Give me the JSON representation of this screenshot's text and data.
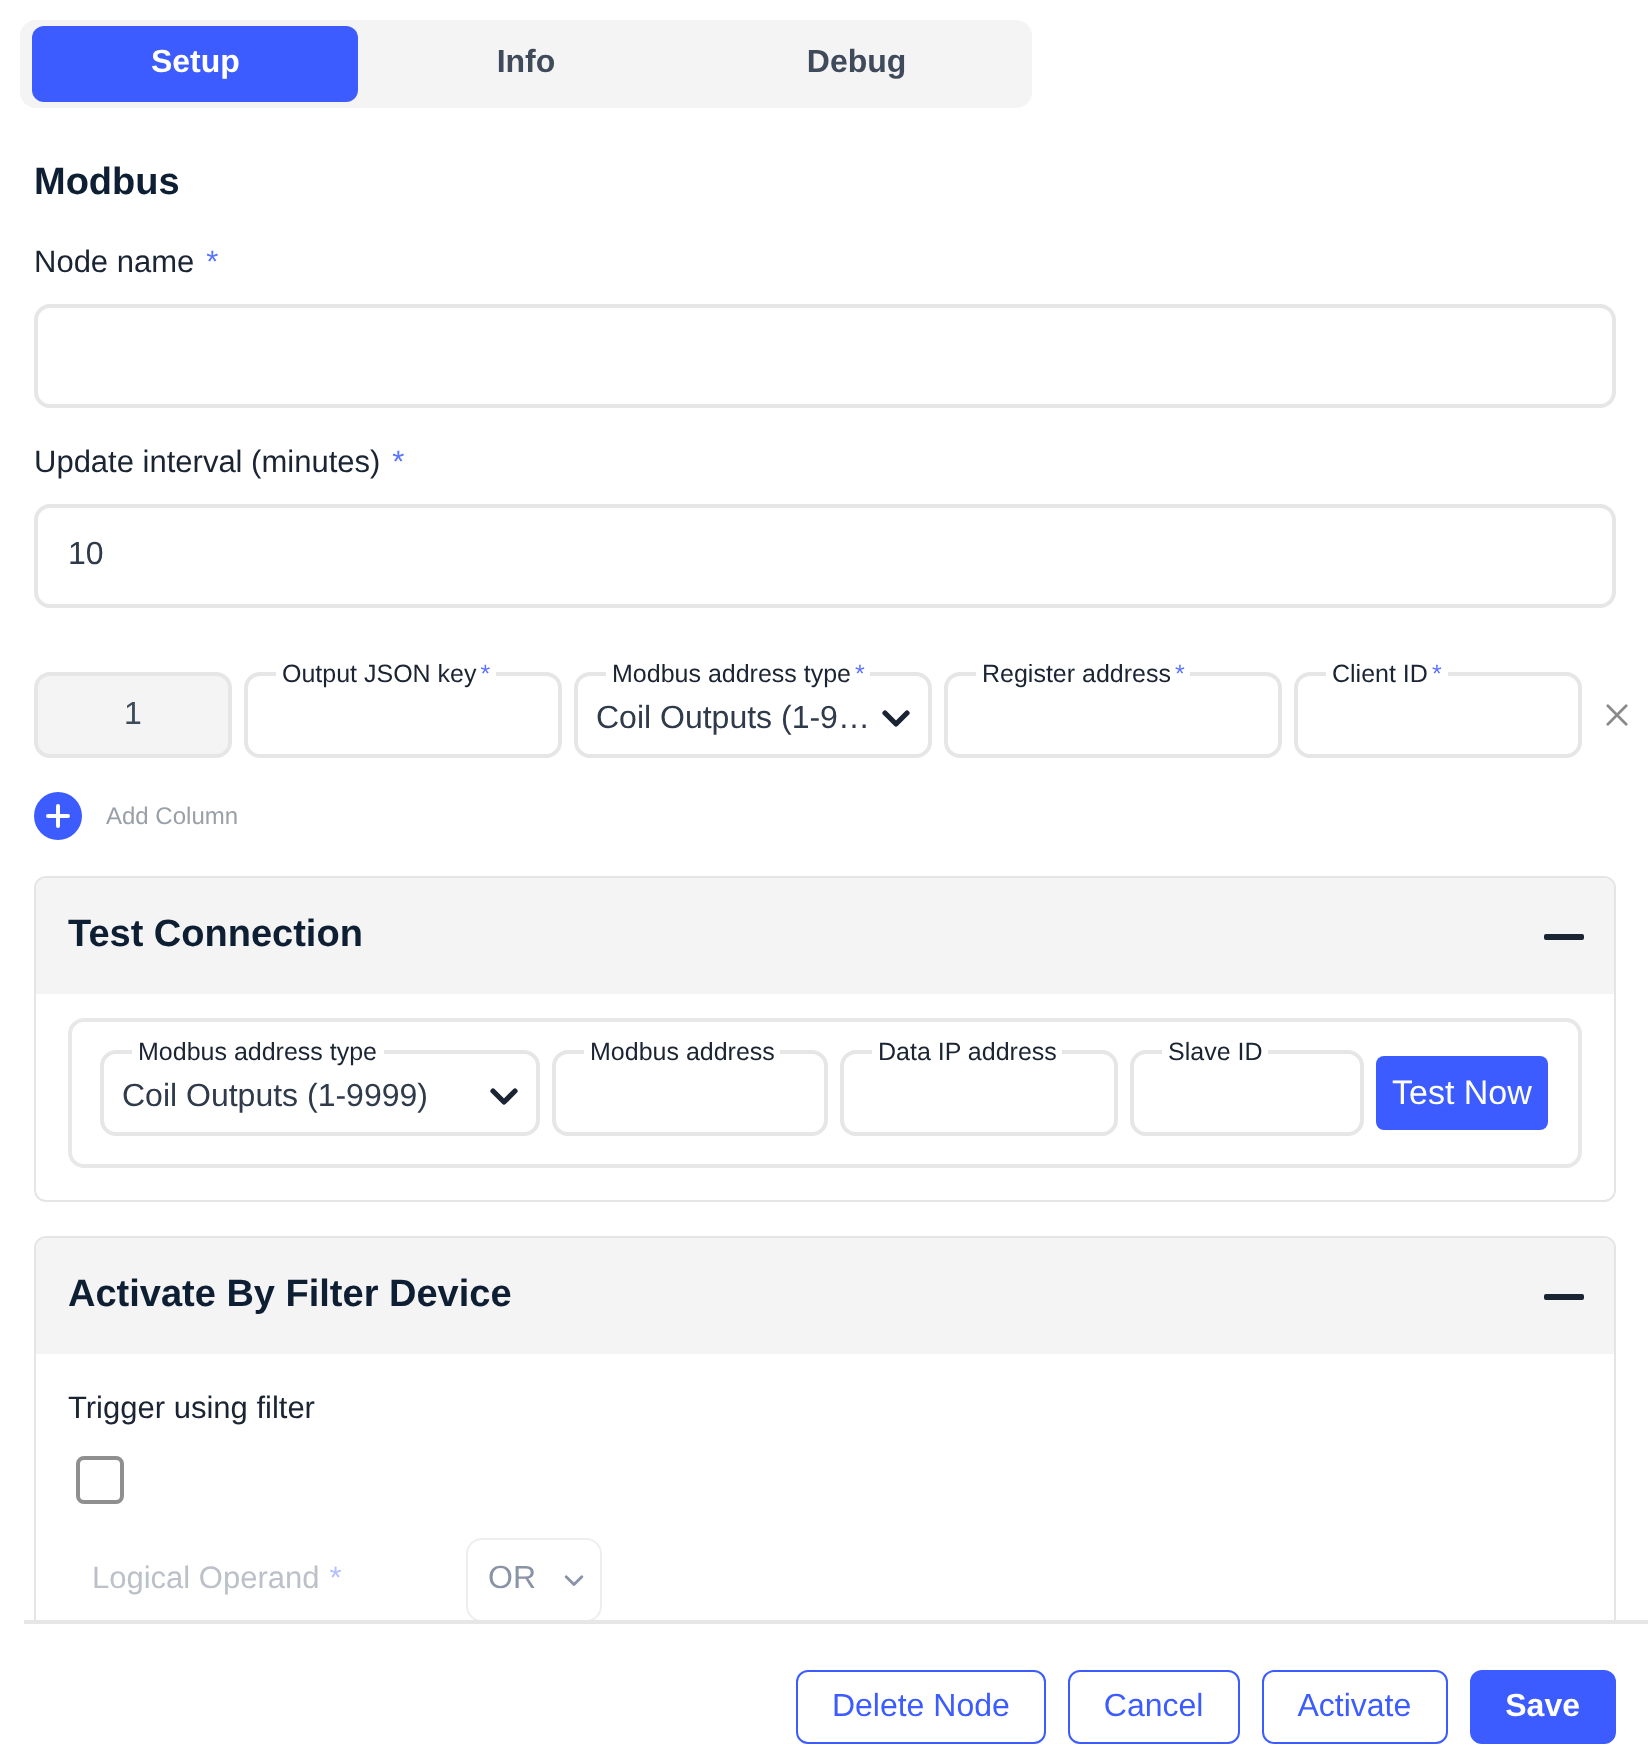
{
  "tabs": [
    {
      "label": "Setup",
      "selected": true
    },
    {
      "label": "Info",
      "selected": false
    },
    {
      "label": "Debug",
      "selected": false
    }
  ],
  "section_title": "Modbus",
  "fields": [
    {
      "label": "Node name",
      "required_mark": "*"
    },
    {
      "label": "Update interval (minutes)",
      "required_mark": "*",
      "value": "10"
    }
  ],
  "column_rows": [
    {
      "index": "1",
      "fields": [
        {
          "kind": "input",
          "label": "Output JSON key",
          "required_mark": "*"
        },
        {
          "kind": "select",
          "label": "Modbus address type",
          "required_mark": "*",
          "value": "Coil Outputs (1-9…"
        },
        {
          "kind": "input",
          "label": "Register address",
          "required_mark": "*"
        },
        {
          "kind": "input",
          "label": "Client ID",
          "required_mark": "*"
        }
      ]
    }
  ],
  "add_column": {
    "label": "Add Column"
  },
  "panels": [
    {
      "kind": "test_connection",
      "title": "Test Connection",
      "expanded": true,
      "fields": [
        {
          "kind": "select",
          "label": "Modbus address type",
          "value": "Coil Outputs (1-9999)"
        },
        {
          "kind": "input",
          "label": "Modbus address"
        },
        {
          "kind": "input",
          "label": "Data IP address"
        },
        {
          "kind": "input",
          "label": "Slave ID"
        }
      ],
      "button": "Test Now"
    },
    {
      "kind": "filter",
      "title": "Activate By Filter Device",
      "expanded": true,
      "trigger": {
        "label": "Trigger using filter",
        "checked": false
      },
      "logical_operand": {
        "label": "Logical Operand",
        "required_mark": "*",
        "value": "OR",
        "disabled": true
      }
    }
  ],
  "footer_buttons": [
    {
      "label": "Delete Node",
      "kind": "outline"
    },
    {
      "label": "Cancel",
      "kind": "outline"
    },
    {
      "label": "Activate",
      "kind": "outline"
    },
    {
      "label": "Save",
      "kind": "primary"
    }
  ]
}
